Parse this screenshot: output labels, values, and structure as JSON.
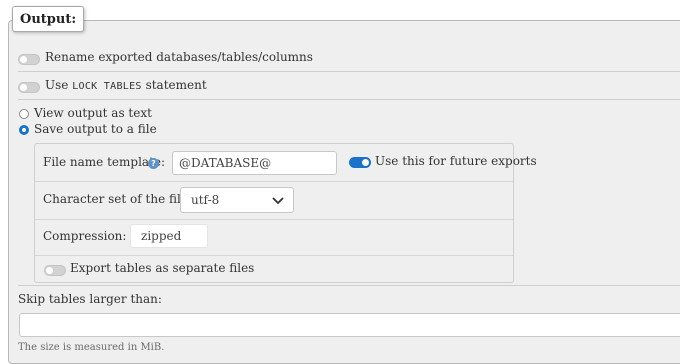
{
  "legend": {
    "title": "Output:"
  },
  "options": {
    "rename": {
      "label": "Rename exported databases/tables/columns",
      "enabled": false
    },
    "lock_tables": {
      "label_pre": "Use",
      "label_code": "LOCK TABLES",
      "label_post": "statement",
      "enabled": false
    }
  },
  "output_mode": {
    "view_as_text": {
      "label": "View output as text",
      "selected": false
    },
    "save_to_file": {
      "label": "Save output to a file",
      "selected": true
    }
  },
  "file_options": {
    "file_name_template": {
      "label": "File name template:",
      "value": "@DATABASE@",
      "help_icon": "help-icon",
      "future_label": "Use this for future exports",
      "future_enabled": true
    },
    "charset": {
      "label": "Character set of the file:",
      "value": "utf-8"
    },
    "compression": {
      "label": "Compression:",
      "value": "zipped"
    },
    "separate_files": {
      "label": "Export tables as separate files",
      "enabled": false
    }
  },
  "skip_tables": {
    "label": "Skip tables larger than:",
    "value": "",
    "note": "The size is measured in MiB."
  },
  "colors": {
    "accent": "#1a73c8",
    "panel_bg": "#efefef",
    "border": "#cfcfcf"
  }
}
